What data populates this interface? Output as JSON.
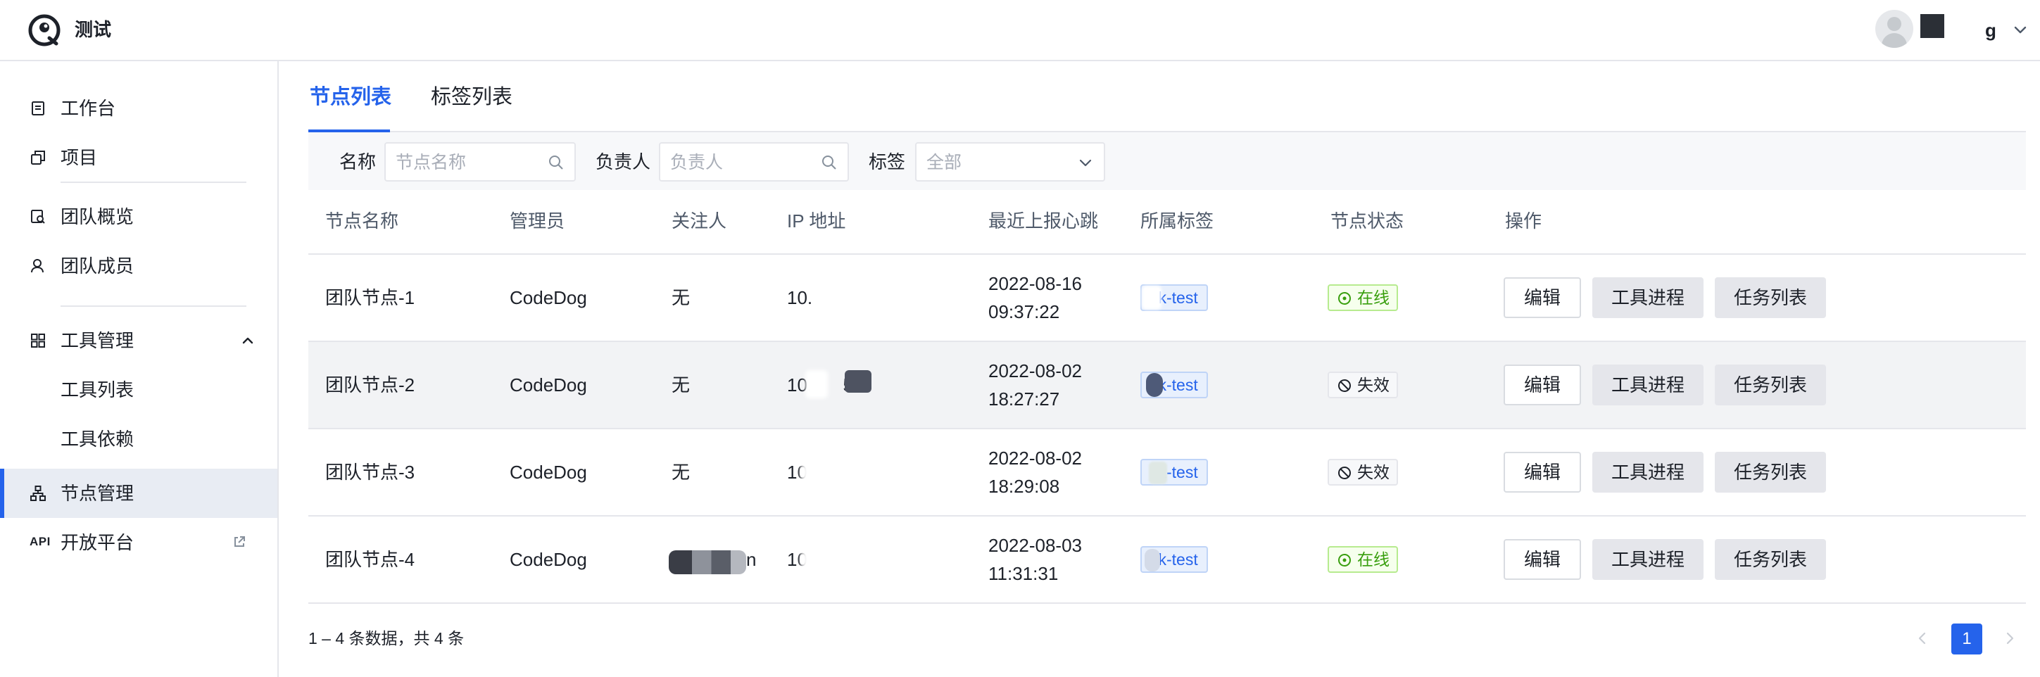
{
  "app": {
    "title": "测试",
    "user_name_partial": "g"
  },
  "sidebar": {
    "items": [
      {
        "label": "工作台"
      },
      {
        "label": "项目"
      },
      {
        "label": "团队概览"
      },
      {
        "label": "团队成员"
      },
      {
        "label": "工具管理"
      },
      {
        "label": "工具列表"
      },
      {
        "label": "工具依赖"
      },
      {
        "label": "节点管理"
      },
      {
        "label": "开放平台",
        "prefix": "API"
      }
    ]
  },
  "tabs": [
    {
      "label": "节点列表"
    },
    {
      "label": "标签列表"
    }
  ],
  "filters": {
    "name_label": "名称",
    "name_placeholder": "节点名称",
    "owner_label": "负责人",
    "owner_placeholder": "负责人",
    "tag_label": "标签",
    "tag_value": "全部"
  },
  "table": {
    "headers": [
      "节点名称",
      "管理员",
      "关注人",
      "IP 地址",
      "最近上报心跳",
      "所属标签",
      "节点状态",
      "操作"
    ],
    "rows": [
      {
        "name": "团队节点-1",
        "admin": "CodeDog",
        "watcher": "无",
        "ip": "10.",
        "date": "2022-08-16",
        "time": "09:37:22",
        "tag": "ck-test",
        "status": "在线",
        "online": true
      },
      {
        "name": "团队节点-2",
        "admin": "CodeDog",
        "watcher": "无",
        "ip": "10.      58",
        "date": "2022-08-02",
        "time": "18:27:27",
        "tag": "ck-test",
        "status": "失效",
        "online": false
      },
      {
        "name": "团队节点-3",
        "admin": "CodeDog",
        "watcher": "无",
        "ip": "10",
        "date": "2022-08-02",
        "time": "18:29:08",
        "tag": "ck-test",
        "status": "失效",
        "online": false
      },
      {
        "name": "团队节点-4",
        "admin": "CodeDog",
        "watcher": "n",
        "ip": "10",
        "date": "2022-08-03",
        "time": "11:31:31",
        "tag": "ck-test",
        "status": "在线",
        "online": true
      }
    ],
    "actions": {
      "edit": "编辑",
      "process": "工具进程",
      "tasks": "任务列表"
    }
  },
  "pagination": {
    "summary": "1 – 4 条数据，共 4 条",
    "current": "1"
  },
  "colors": {
    "accent": "#2563eb",
    "online": "#389e0d"
  }
}
